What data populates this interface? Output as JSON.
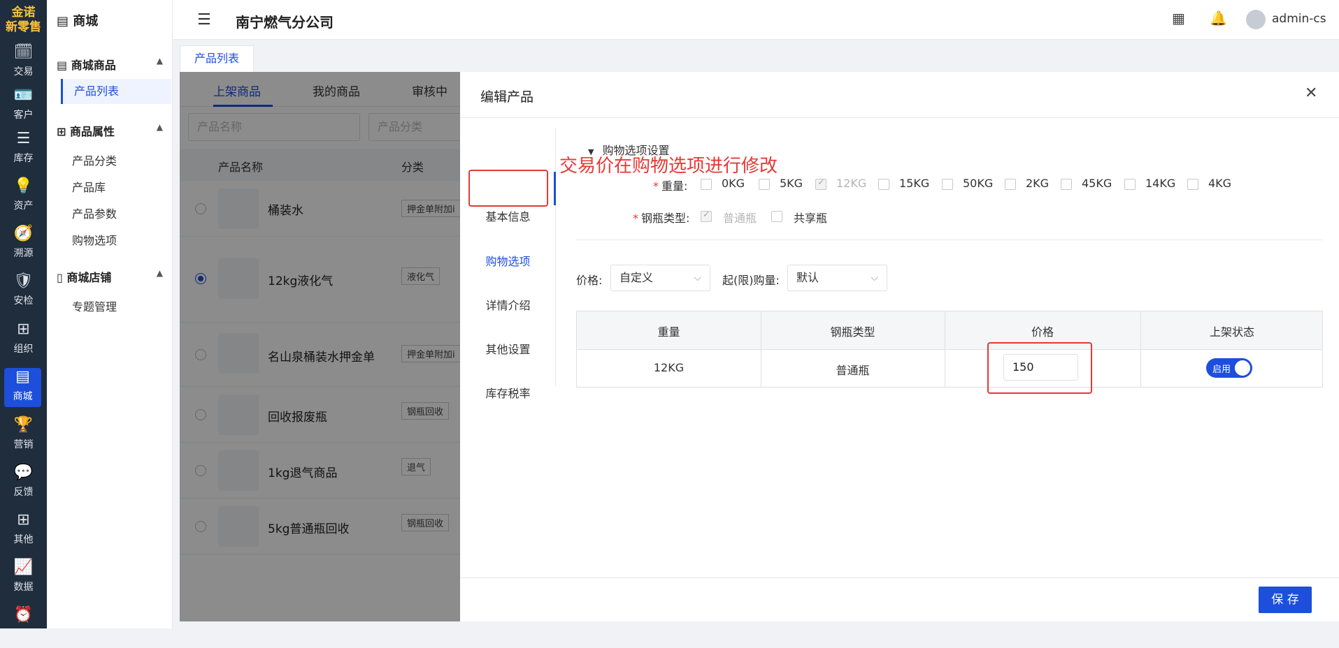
{
  "logo": {
    "line1": "金诺",
    "line2": "新零售"
  },
  "rail": [
    {
      "label": "交易",
      "icon": "calendar-icon"
    },
    {
      "label": "客户",
      "icon": "id-card-icon"
    },
    {
      "label": "库存",
      "icon": "list-icon"
    },
    {
      "label": "资产",
      "icon": "bulb-icon"
    },
    {
      "label": "溯源",
      "icon": "compass-icon"
    },
    {
      "label": "安检",
      "icon": "shield-icon"
    },
    {
      "label": "组织",
      "icon": "org-icon"
    },
    {
      "label": "商城",
      "icon": "store-icon"
    },
    {
      "label": "营销",
      "icon": "trophy-icon"
    },
    {
      "label": "反馈",
      "icon": "chat-icon"
    },
    {
      "label": "其他",
      "icon": "apps-icon"
    },
    {
      "label": "数据",
      "icon": "chart-icon"
    },
    {
      "label": "",
      "icon": "alarm-icon"
    }
  ],
  "submenu": {
    "title": "商城",
    "groups": [
      {
        "label": "商城商品",
        "items": [
          "产品列表"
        ]
      },
      {
        "label": "商品属性",
        "items": [
          "产品分类",
          "产品库",
          "产品参数",
          "购物选项"
        ]
      },
      {
        "label": "商城店铺",
        "items": [
          "专题管理"
        ]
      }
    ]
  },
  "header": {
    "company": "南宁燃气分公司",
    "username": "admin-cs"
  },
  "page_tab": "产品列表",
  "content": {
    "tabs": [
      "上架商品",
      "我的商品",
      "审核中"
    ],
    "filters": [
      "产品名称",
      "产品分类"
    ],
    "columns": [
      "产品名称",
      "分类"
    ],
    "rows": [
      {
        "name": "桶装水",
        "category": "押金单附加i"
      },
      {
        "name": "12kg液化气",
        "category": "液化气"
      },
      {
        "name": "名山泉桶装水押金单",
        "category": "押金单附加i"
      },
      {
        "name": "回收报废瓶",
        "category": "钢瓶回收"
      },
      {
        "name": "1kg退气商品",
        "category": "退气"
      },
      {
        "name": "5kg普通瓶回收",
        "category": "钢瓶回收"
      }
    ]
  },
  "drawer": {
    "title": "编辑产品",
    "nav": [
      "基本信息",
      "购物选项",
      "详情介绍",
      "其他设置",
      "库存税率"
    ],
    "section_title": "购物选项设置",
    "annotation": "交易价在购物选项进行修改",
    "weight_label": "重量:",
    "weights": [
      "0KG",
      "5KG",
      "12KG",
      "15KG",
      "50KG",
      "2KG",
      "45KG",
      "14KG",
      "4KG"
    ],
    "weight_checked": "12KG",
    "bottle_label": "钢瓶类型:",
    "bottle_types": [
      "普通瓶",
      "共享瓶"
    ],
    "bottle_checked": "普通瓶",
    "price_label": "价格:",
    "price_mode": "自定义",
    "limit_label": "起(限)购量:",
    "limit_mode": "默认",
    "table": {
      "headers": [
        "重量",
        "钢瓶类型",
        "价格",
        "上架状态"
      ],
      "row": {
        "weight": "12KG",
        "bottle": "普通瓶",
        "price": "150",
        "status": "启用"
      }
    },
    "save": "保 存"
  },
  "colors": {
    "primary": "#1d4fdc",
    "annotation": "#e53935",
    "rail_bg": "#1f2d3d"
  }
}
